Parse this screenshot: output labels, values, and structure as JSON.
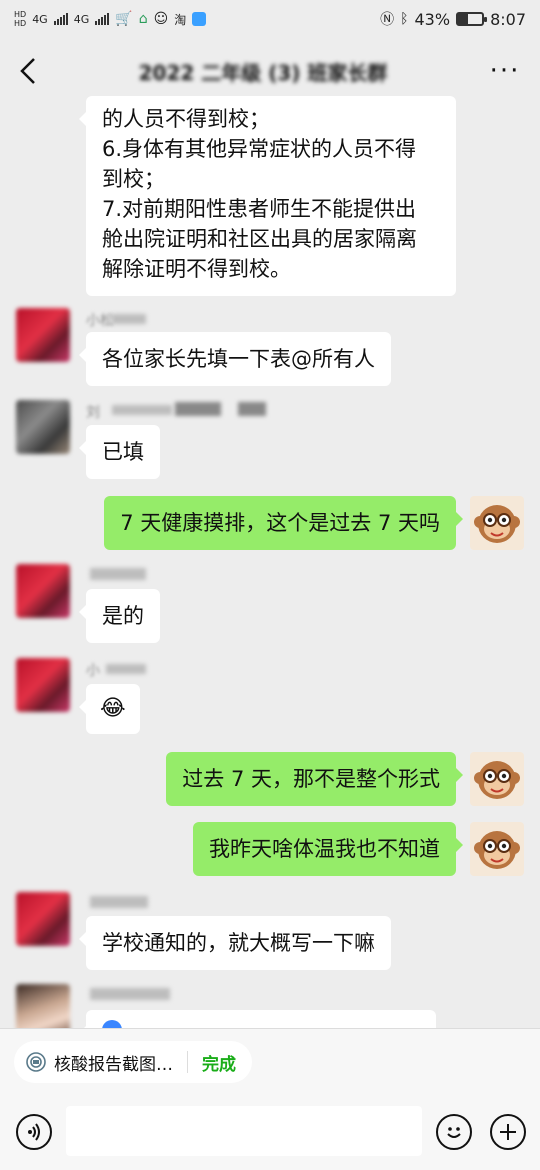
{
  "status_bar": {
    "battery": "43%",
    "time": "8:07",
    "carrier": "淘",
    "battery_level": 0.43
  },
  "header": {
    "title": "2022 二年级 (3) 班家长群",
    "more": "···"
  },
  "messages": [
    {
      "type": "in",
      "text_lines": [
        "的人员不得到校；",
        "6.身体有其他异常症状的人员不得",
        "到校；",
        "7.对前期阳性患者师生不能提供出",
        "舱出院证明和社区出具的居家隔离",
        "解除证明不得到校。"
      ]
    },
    {
      "type": "in",
      "sender": "小松",
      "text": "各位家长先填一下表@所有人"
    },
    {
      "type": "in",
      "sender": "刘",
      "text": "已填"
    },
    {
      "type": "out",
      "text": "7 天健康摸排，这个是过去 7 天吗"
    },
    {
      "type": "in",
      "sender": "",
      "text": "是的"
    },
    {
      "type": "in",
      "sender": "小",
      "text": "😂"
    },
    {
      "type": "out",
      "text": "过去 7 天，那不是整个形式"
    },
    {
      "type": "out",
      "text": "我昨天啥体温我也不知道"
    },
    {
      "type": "in",
      "sender": "",
      "text": "学校通知的，就大概写一下嘛"
    },
    {
      "type": "in",
      "sender": "",
      "text": ""
    }
  ],
  "bottom": {
    "tag_label": "核酸报告截图…",
    "done_label": "完成"
  }
}
